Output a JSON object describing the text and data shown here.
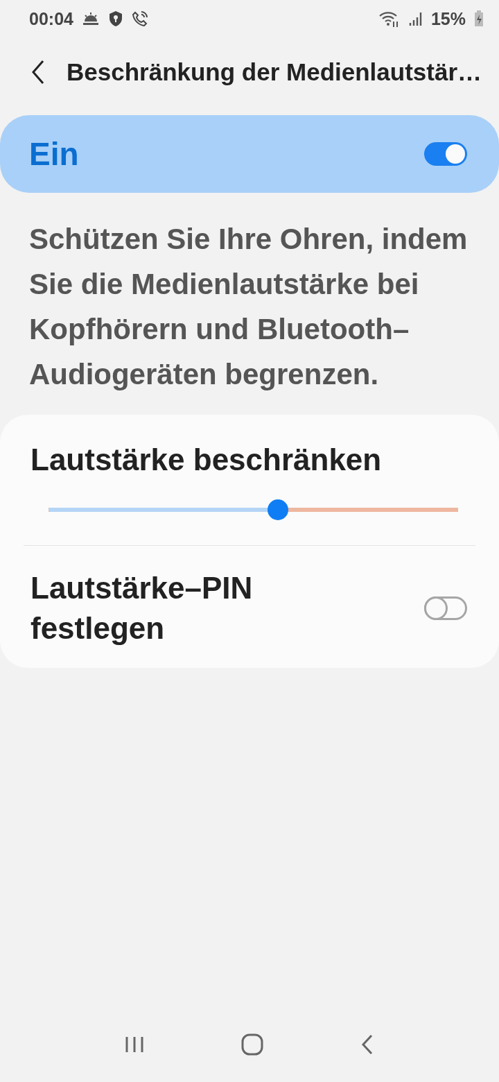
{
  "status_bar": {
    "time": "00:04",
    "battery": "15%"
  },
  "header": {
    "title": "Beschränkung der Medienlautstär…"
  },
  "master_switch": {
    "label": "Ein",
    "on": true
  },
  "description": "Schützen Sie Ihre Ohren, indem Sie die Medienlautstärke bei Kopfhörern und Bluetooth–Audiogeräten begrenzen.",
  "settings": [
    {
      "kind": "slider",
      "label": "Lautstärke beschränken",
      "level": 0.56
    },
    {
      "kind": "switch",
      "label": "Lautstärke–PIN festlegen",
      "on": false
    }
  ]
}
